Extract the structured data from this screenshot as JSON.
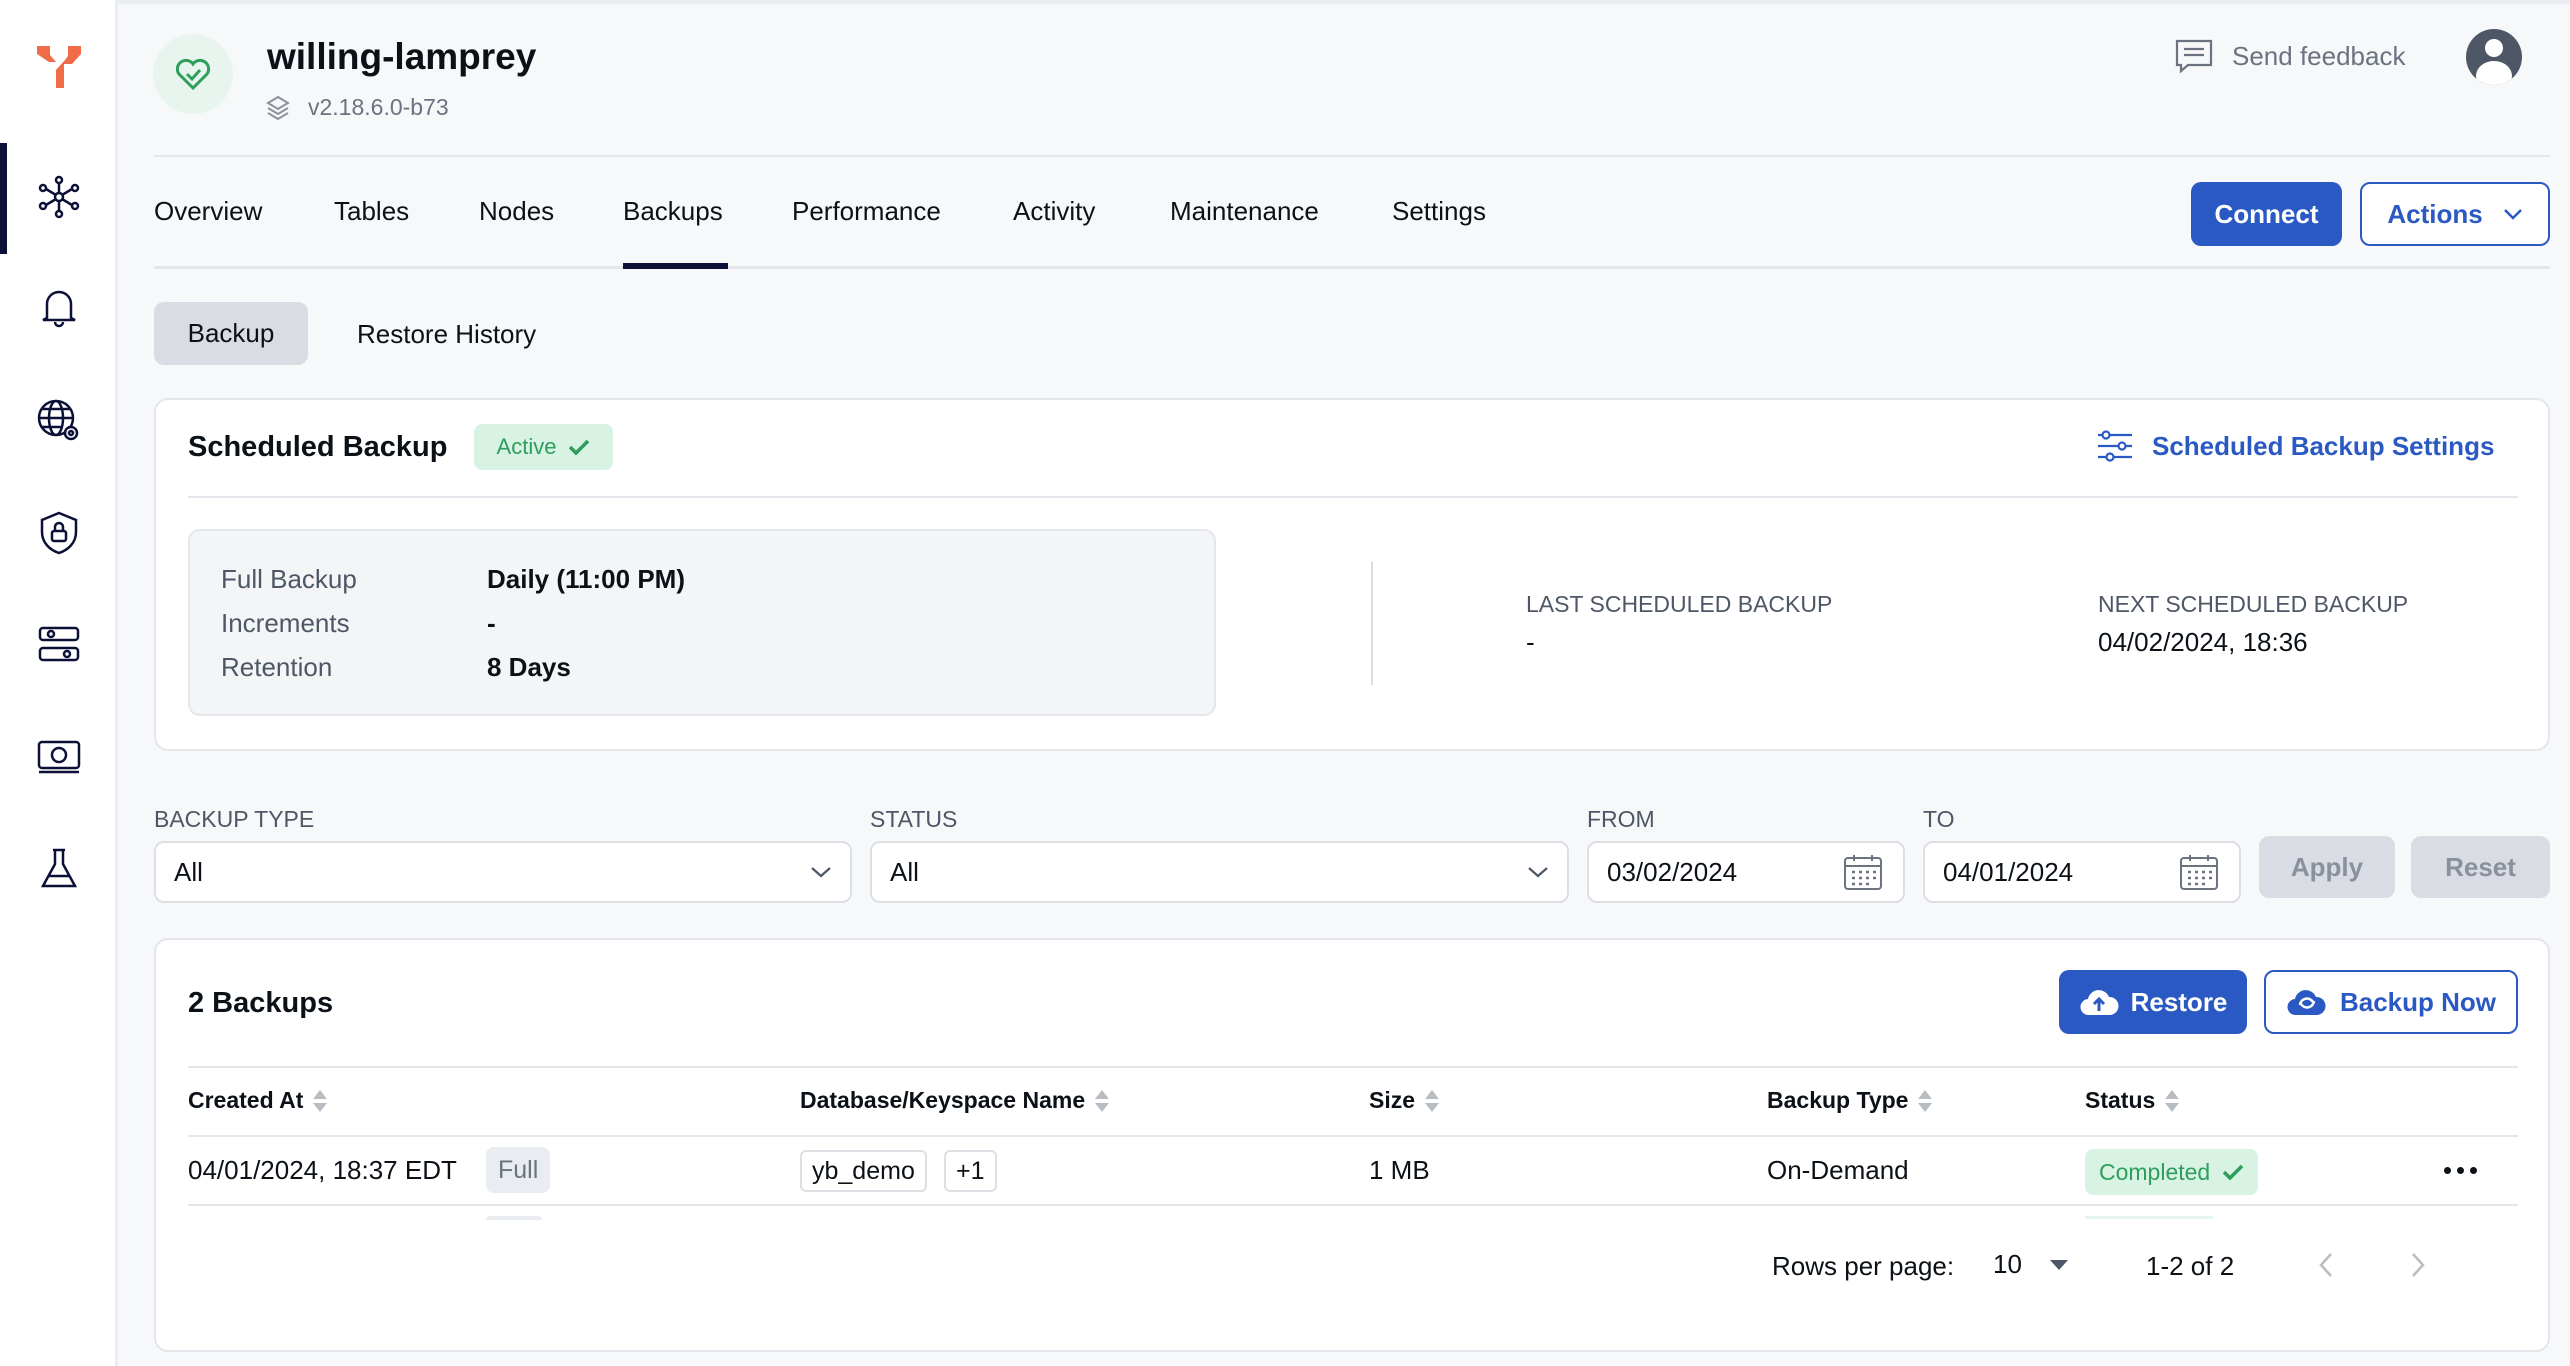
{
  "app": {
    "title": "willing-lamprey",
    "version": "v2.18.6.0-b73",
    "send_feedback": "Send feedback"
  },
  "sidebar": {
    "items": [
      {
        "icon": "universe-icon",
        "active": true
      },
      {
        "icon": "bell-icon"
      },
      {
        "icon": "globe-gear-icon"
      },
      {
        "icon": "shield-lock-icon"
      },
      {
        "icon": "sliders-icon"
      },
      {
        "icon": "billing-icon"
      },
      {
        "icon": "flask-icon"
      }
    ]
  },
  "tabs": [
    "Overview",
    "Tables",
    "Nodes",
    "Backups",
    "Performance",
    "Activity",
    "Maintenance",
    "Settings"
  ],
  "active_tab": "Backups",
  "header_buttons": {
    "connect": "Connect",
    "actions": "Actions"
  },
  "subtabs": [
    "Backup",
    "Restore History"
  ],
  "scheduled": {
    "title": "Scheduled Backup",
    "status": "Active",
    "settings_link": "Scheduled Backup Settings",
    "rows": [
      {
        "label": "Full Backup",
        "value": "Daily (11:00 PM)"
      },
      {
        "label": "Increments",
        "value": "-"
      },
      {
        "label": "Retention",
        "value": "8 Days"
      }
    ],
    "last_label": "LAST SCHEDULED BACKUP",
    "last_value": "-",
    "next_label": "NEXT SCHEDULED BACKUP",
    "next_value": "04/02/2024, 18:36"
  },
  "filters": {
    "backup_type_label": "BACKUP TYPE",
    "backup_type": "All",
    "status_label": "STATUS",
    "status": "All",
    "from_label": "FROM",
    "from": "03/02/2024",
    "to_label": "TO",
    "to": "04/01/2024",
    "apply": "Apply",
    "reset": "Reset"
  },
  "backups": {
    "title": "2 Backups",
    "restore": "Restore",
    "backup_now": "Backup Now",
    "columns": [
      "Created At",
      "Database/Keyspace Name",
      "Size",
      "Backup Type",
      "Status"
    ],
    "rows": [
      {
        "created": "04/01/2024, 18:37 EDT",
        "kind": "Full",
        "db": "yb_demo",
        "more": "+1",
        "size": "1 MB",
        "type": "On-Demand",
        "status": "Completed"
      }
    ],
    "pagination": {
      "rows_per_page_label": "Rows per page:",
      "rows_per_page": "10",
      "range": "1-2 of 2"
    }
  },
  "colors": {
    "primary": "#2b59c3",
    "nav": "#0b1136",
    "success": "#2e9e5b",
    "logo": "#ef6c47"
  }
}
